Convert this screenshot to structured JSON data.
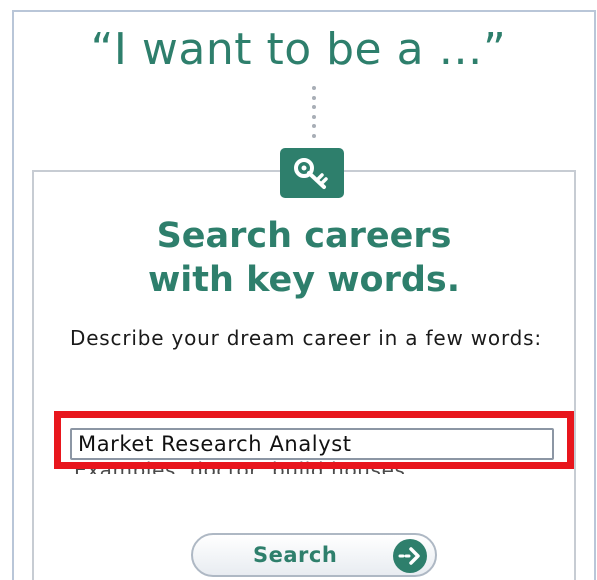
{
  "tagline": "“I want to be a …”",
  "icons": {
    "key": "key-icon",
    "arrow": "arrow-right-icon"
  },
  "heading": {
    "line1": "Search careers",
    "line2": "with key words."
  },
  "prompt": "Describe your dream career in a few words:",
  "search": {
    "value": "Market Research Analyst",
    "examples": "Examples: doctor, build houses",
    "button_label": "Search"
  },
  "colors": {
    "brand_green": "#2e7f6c",
    "highlight_red": "#e8161d"
  }
}
